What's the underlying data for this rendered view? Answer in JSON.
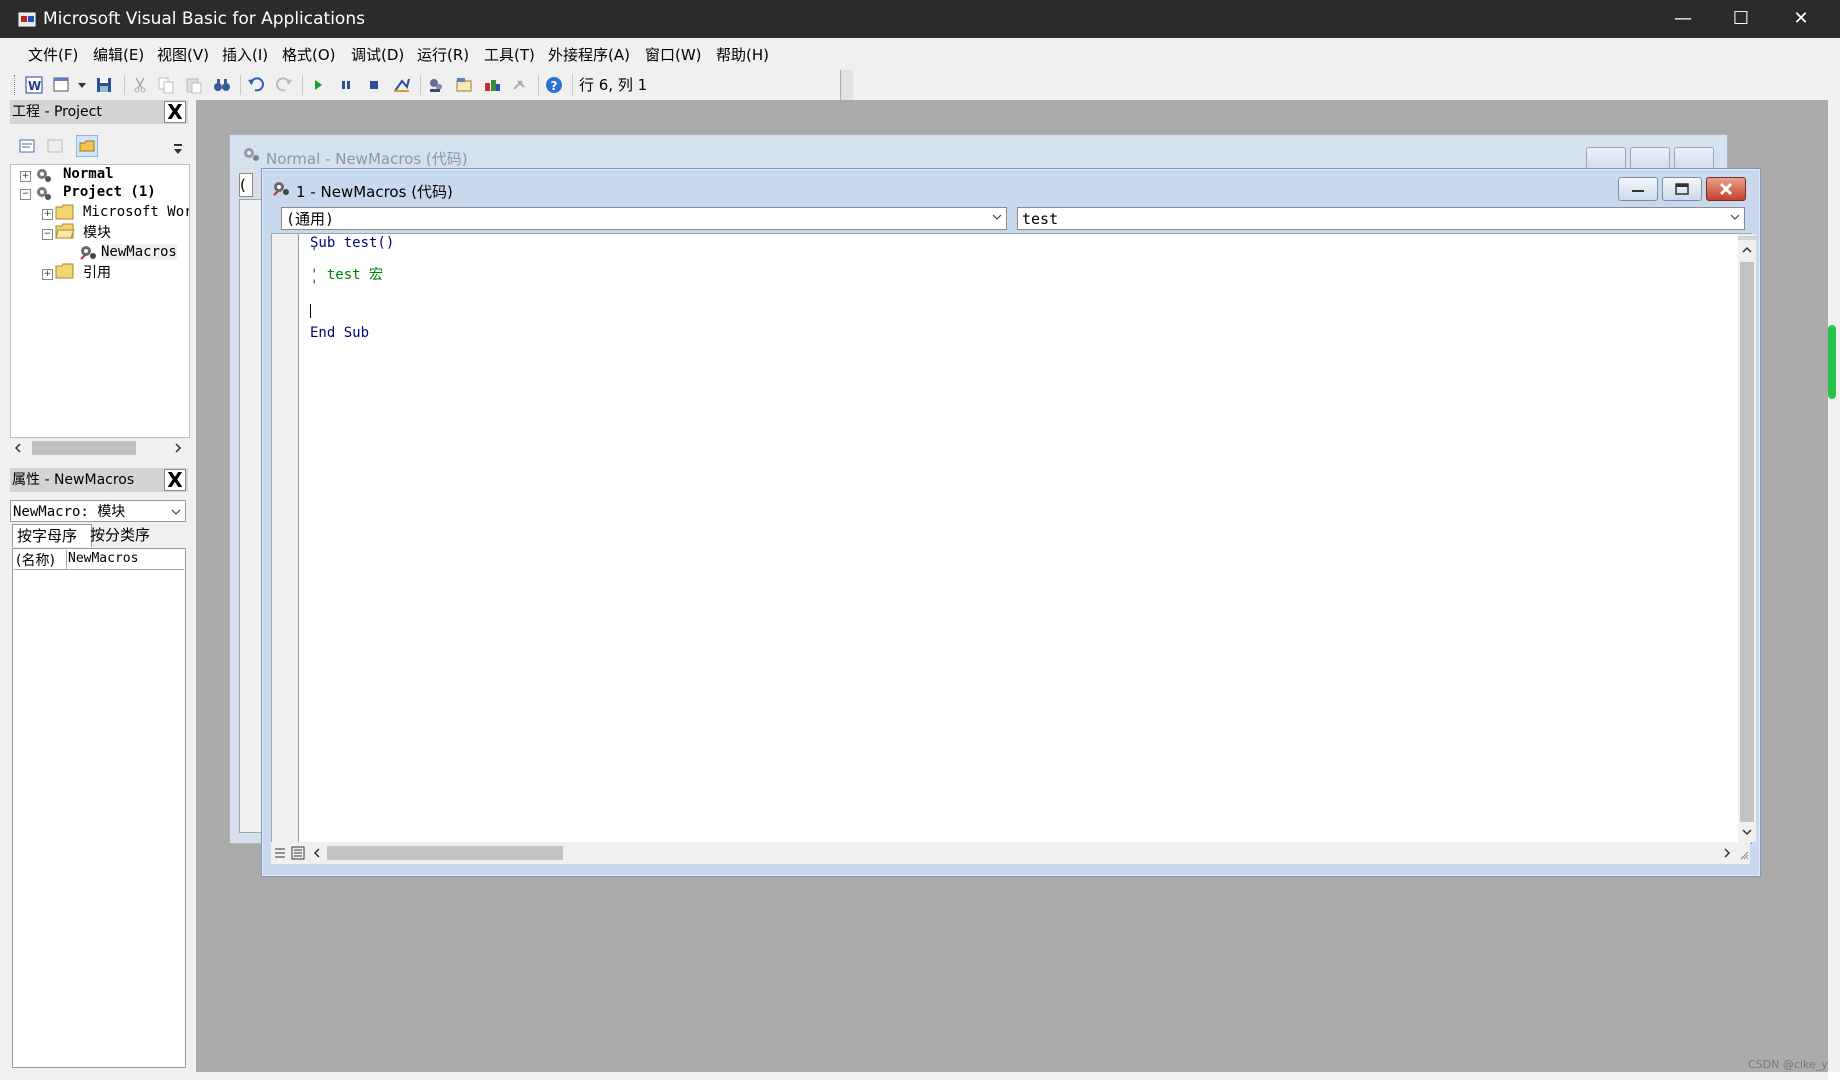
{
  "app": {
    "title": "Microsoft Visual Basic for Applications",
    "controls": {
      "minimize": "—",
      "maximize": "☐",
      "close": "✕"
    }
  },
  "menu": [
    "文件(F)",
    "编辑(E)",
    "视图(V)",
    "插入(I)",
    "格式(O)",
    "调试(D)",
    "运行(R)",
    "工具(T)",
    "外接程序(A)",
    "窗口(W)",
    "帮助(H)"
  ],
  "toolbar": {
    "position": "行 6, 列 1"
  },
  "project": {
    "caption": "工程 - Project",
    "close": "X",
    "tree": {
      "normal": "Normal",
      "project": "Project (1)",
      "microsoft_objects": "Microsoft Wor",
      "modules": "模块",
      "newmacros": "NewMacros",
      "references": "引用"
    }
  },
  "properties": {
    "caption": "属性 - NewMacros",
    "close": "X",
    "object_combo": "NewMacro: 模块",
    "tabs": [
      "按字母序",
      "按分类序"
    ],
    "rows": [
      {
        "name": "(名称)",
        "value": "NewMacros"
      }
    ]
  },
  "back_window": {
    "title": "Normal - NewMacros (代码)",
    "combo": "("
  },
  "code_window": {
    "title": "1 - NewMacros (代码)",
    "object_combo": "(通用)",
    "proc_combo": "test",
    "lines": [
      {
        "text": "Sub test()",
        "color": "#000080"
      },
      {
        "text": "'",
        "color": "#008000"
      },
      {
        "text": "' test 宏",
        "color": "#008000"
      },
      {
        "text": "'",
        "color": "#008000"
      },
      {
        "text": "",
        "color": "#000000"
      },
      {
        "text": "End Sub",
        "color": "#000080"
      }
    ]
  },
  "colors": {
    "mdi_background": "#ababab",
    "titlebar": "#2b2b2b",
    "keyword": "#000080",
    "comment": "#008000"
  },
  "watermark": "CSDN @cike_y"
}
